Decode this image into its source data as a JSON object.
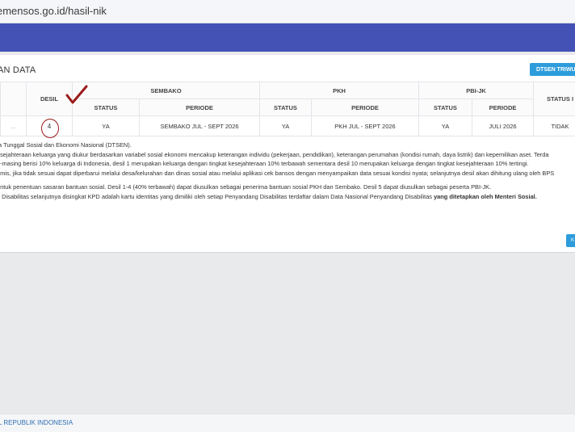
{
  "browser": {
    "url": "emensos.go.id/hasil-nik"
  },
  "card": {
    "title": "AN DATA",
    "dtsen_button": "DTSEN TRIWULA"
  },
  "table": {
    "headers": {
      "desil": "DESIL",
      "sembako": "SEMBAKO",
      "pkh": "PKH",
      "pbi_jk": "PBI-JK",
      "status_last": "STATUS I",
      "status": "STATUS",
      "periode": "PERIODE"
    },
    "row": {
      "lead": "...",
      "desil": "4",
      "sembako_status": "YA",
      "sembako_periode": "SEMBAKO JUL - SEPT 2026",
      "pkh_status": "YA",
      "pkh_periode": "PKH JUL - SEPT 2026",
      "pbi_status": "YA",
      "pbi_periode": "JULI 2026",
      "status_last": "TIDAK"
    }
  },
  "notes": {
    "line1": "ta Tunggal Sosial dan Ekonomi Nasional (DTSEN).",
    "line2": "esejahteraan keluarga yang diukur berdasarkan variabel sosial ekonomi mencakup keterangan individu (pekerjaan, pendidikan), keterangan perumahan (kondisi rumah, daya listrik) dan kepemilikan aset. Terda",
    "line3": "g-masing berisi 10% keluarga di Indonesia, desil 1 merupakan keluarga dengan tingkat kesejahteraan 10% terbawah sementara desil 10 merupakan keluarga dengan tingkat kesejahteraan 10% tertingi.",
    "line4": "amis, jika tidak sesuai dapat diperbarui melalui desa/kelurahan dan dinas sosial atau melalui aplikasi cek bansos dengan menyampaikan data sesuai kondisi nyata; selanjutnya desil akan dihitung ulang oleh BPS",
    "line5": "untuk penentuan sasaran bantuan sosial. Desil 1-4 (40% terbawah) dapat diusulkan sebagai penerima bantuan sosial PKH dan Sembako. Desil 5 dapat diusulkan sebagai peserta PBI-JK.",
    "line6_a": "g Disabilitas selanjutnya disingkat KPD adalah kartu identitas yang dimiliki oleh setiap Penyandang Disabilitas terdaftar dalam Data Nasional Penyandang Disabilitas ",
    "line6_b": "yang ditetapkan oleh Menteri Sosial."
  },
  "small_button": "K",
  "footer": {
    "text": "L REPUBLIK INDONESIA"
  },
  "colors": {
    "navbar": "#4452b6",
    "button": "#2d9cdb",
    "annotation": "#9b1b1b",
    "footer_link": "#2e6fb3"
  }
}
